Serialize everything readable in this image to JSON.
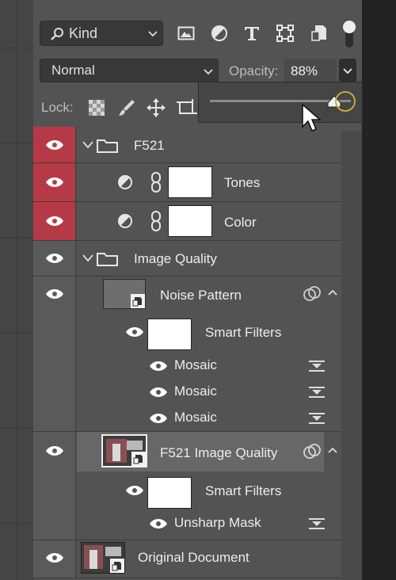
{
  "filter_bar": {
    "kind_label": "Kind"
  },
  "blend": {
    "mode": "Normal",
    "opacity_label": "Opacity:",
    "opacity_value": "88%"
  },
  "lock": {
    "label": "Lock:"
  },
  "opacity_slider": {
    "value_fraction": 0.88
  },
  "layers": {
    "f521_group": {
      "name": "F521"
    },
    "tones": {
      "name": "Tones"
    },
    "color": {
      "name": "Color"
    },
    "image_quality_group": {
      "name": "Image Quality"
    },
    "noise_pattern": {
      "name": "Noise Pattern"
    },
    "noise_smart_filters": {
      "name": "Smart Filters"
    },
    "mosaic_1": {
      "name": "Mosaic"
    },
    "mosaic_2": {
      "name": "Mosaic"
    },
    "mosaic_3": {
      "name": "Mosaic"
    },
    "f521_image_quality": {
      "name": "F521 Image Quality"
    },
    "iq_smart_filters": {
      "name": "Smart Filters"
    },
    "unsharp_mask": {
      "name": "Unsharp Mask"
    },
    "original_document": {
      "name": "Original Document"
    }
  },
  "colors": {
    "eye_active": "#b53a45",
    "panel_bg": "#535353",
    "highlight": "#c8a83a"
  }
}
